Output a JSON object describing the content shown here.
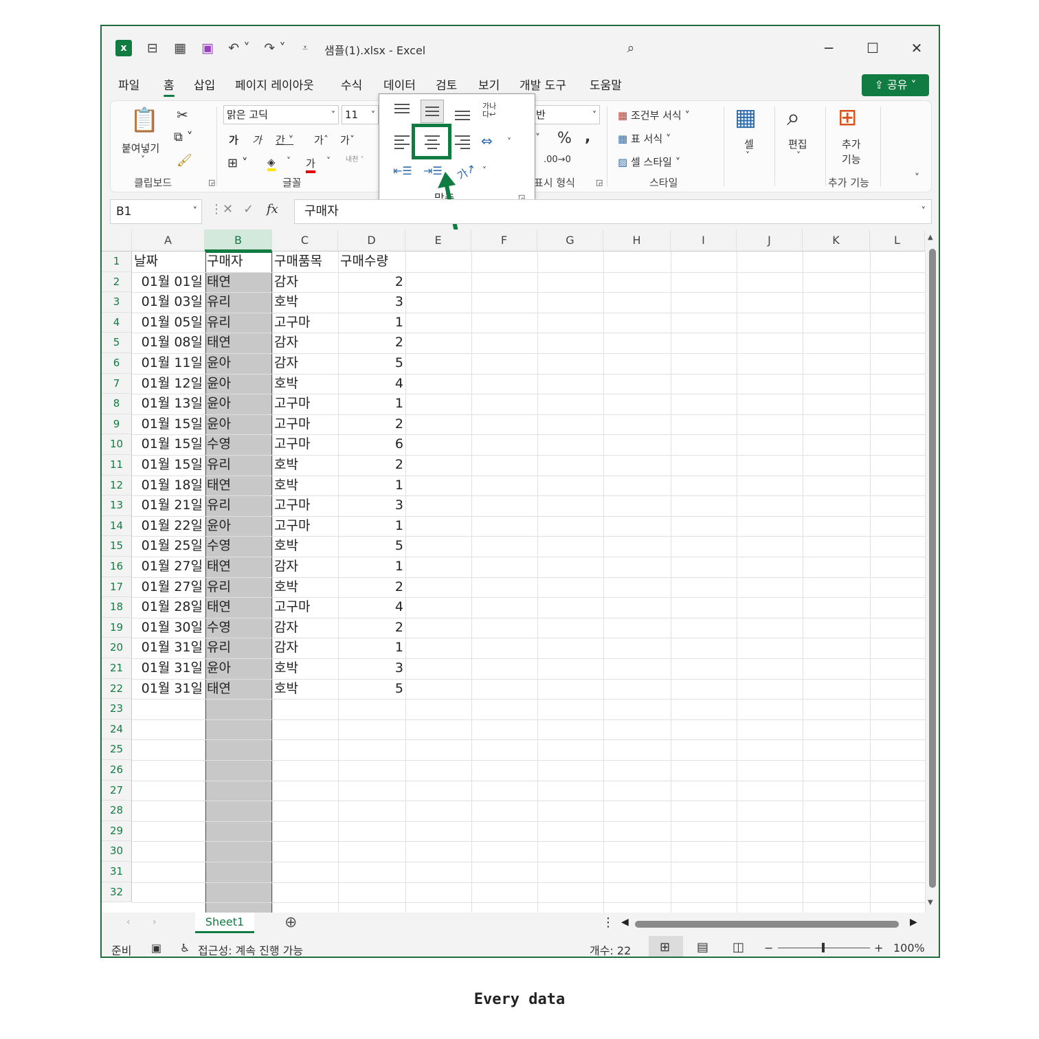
{
  "title_bar": {
    "title": "샘플(1).xlsx  -  Excel"
  },
  "menu": [
    "파일",
    "홈",
    "삽입",
    "페이지 레이아웃",
    "수식",
    "데이터",
    "검토",
    "보기",
    "개발 도구",
    "도움말"
  ],
  "share_label": "공유",
  "ribbon": {
    "paste_label": "붙여넣기",
    "clipboard_label": "클립보드",
    "font_name": "맑은 고딕",
    "font_size": "11",
    "font_label": "글꼴",
    "number_format": "반",
    "number_label": "표시 형식",
    "percent": "%",
    "conditional_format": "조건부 서식",
    "table_format": "표 서식",
    "cell_style": "셀 스타일",
    "style_label": "스타일",
    "cells_label": "셀",
    "edit_label": "편집",
    "addins_label": "추가\n기능",
    "addins_group_label": "추가 기능"
  },
  "alignment_popup": {
    "label": "맞춤"
  },
  "formula_bar": {
    "name_box": "B1",
    "fx": "fx",
    "formula": "구매자"
  },
  "columns": [
    "A",
    "B",
    "C",
    "D",
    "E",
    "F",
    "G",
    "H",
    "I",
    "J",
    "K",
    "L"
  ],
  "selected_column": "B",
  "row_numbers": [
    "1",
    "2",
    "3",
    "4",
    "5",
    "6",
    "7",
    "8",
    "9",
    "10",
    "11",
    "12",
    "13",
    "14",
    "15",
    "16",
    "17",
    "18",
    "19",
    "20",
    "21",
    "22",
    "23",
    "24",
    "25",
    "26",
    "27",
    "28",
    "29",
    "30",
    "31",
    "32"
  ],
  "headers": [
    "날짜",
    "구매자",
    "구매품목",
    "구매수량"
  ],
  "rows": [
    [
      "01월 01일",
      "태연",
      "감자",
      "2"
    ],
    [
      "01월 03일",
      "유리",
      "호박",
      "3"
    ],
    [
      "01월 05일",
      "유리",
      "고구마",
      "1"
    ],
    [
      "01월 08일",
      "태연",
      "감자",
      "2"
    ],
    [
      "01월 11일",
      "윤아",
      "감자",
      "5"
    ],
    [
      "01월 12일",
      "윤아",
      "호박",
      "4"
    ],
    [
      "01월 13일",
      "윤아",
      "고구마",
      "1"
    ],
    [
      "01월 15일",
      "윤아",
      "고구마",
      "2"
    ],
    [
      "01월 15일",
      "수영",
      "고구마",
      "6"
    ],
    [
      "01월 15일",
      "유리",
      "호박",
      "2"
    ],
    [
      "01월 18일",
      "태연",
      "호박",
      "1"
    ],
    [
      "01월 21일",
      "유리",
      "고구마",
      "3"
    ],
    [
      "01월 22일",
      "윤아",
      "고구마",
      "1"
    ],
    [
      "01월 25일",
      "수영",
      "호박",
      "5"
    ],
    [
      "01월 27일",
      "태연",
      "감자",
      "1"
    ],
    [
      "01월 27일",
      "유리",
      "호박",
      "2"
    ],
    [
      "01월 28일",
      "태연",
      "고구마",
      "4"
    ],
    [
      "01월 30일",
      "수영",
      "감자",
      "2"
    ],
    [
      "01월 31일",
      "유리",
      "감자",
      "1"
    ],
    [
      "01월 31일",
      "윤아",
      "호박",
      "3"
    ],
    [
      "01월 31일",
      "태연",
      "호박",
      "5"
    ]
  ],
  "sheet_tab": "Sheet1",
  "status": {
    "ready": "준비",
    "accessibility": "접근성: 계속 진행 가능",
    "count": "개수: 22",
    "zoom": "100%"
  },
  "caption": "Every data",
  "accent_color": "#107c41"
}
